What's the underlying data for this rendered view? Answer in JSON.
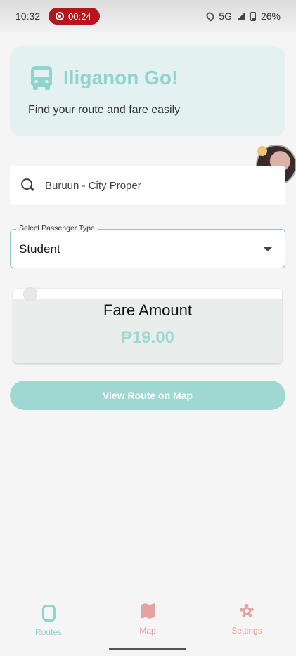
{
  "status_bar": {
    "time": "10:32",
    "recording": "00:24",
    "network": "5G",
    "battery": "26%"
  },
  "header": {
    "app_title": "Iliganon Go!",
    "subtitle": "Find your route and fare easily",
    "icon": "bus-icon"
  },
  "search": {
    "value": "Buruun - City Proper",
    "icon": "search-icon"
  },
  "passenger_select": {
    "label": "Select Passenger Type",
    "value": "Student"
  },
  "fare": {
    "label": "Fare Amount",
    "value": "₱19.00"
  },
  "map_button": {
    "label": "View Route on Map"
  },
  "bottom_nav": {
    "items": [
      {
        "label": "Routes",
        "icon": "routes-icon",
        "active": true
      },
      {
        "label": "Map",
        "icon": "map-icon",
        "active": false
      },
      {
        "label": "Settings",
        "icon": "gear-icon",
        "active": false
      }
    ]
  },
  "colors": {
    "accent": "#8fd4cd",
    "button": "#9fd8d2",
    "inactive_nav": "#e4a3a3",
    "record_pill": "#b3171c"
  }
}
